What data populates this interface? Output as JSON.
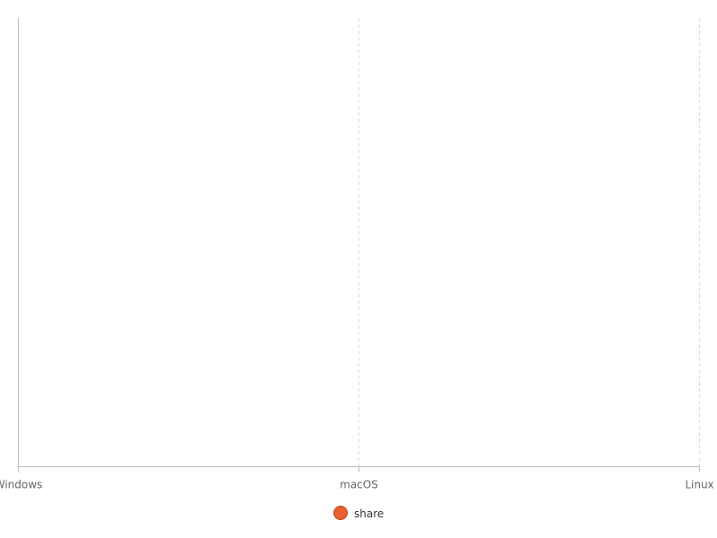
{
  "chart_data": {
    "type": "line",
    "categories": [
      "Windows",
      "macOS",
      "Linux"
    ],
    "series": [
      {
        "name": "share",
        "values": [
          null,
          null,
          null
        ],
        "color": "#e8602f"
      }
    ],
    "grid": true,
    "legend_position": "bottom-center"
  },
  "colors": {
    "axis": "#bbbbbb",
    "grid": "#dddddd",
    "tick_text": "#666666",
    "legend_marker": "#e8602f",
    "legend_marker_stroke": "#c0451c"
  }
}
